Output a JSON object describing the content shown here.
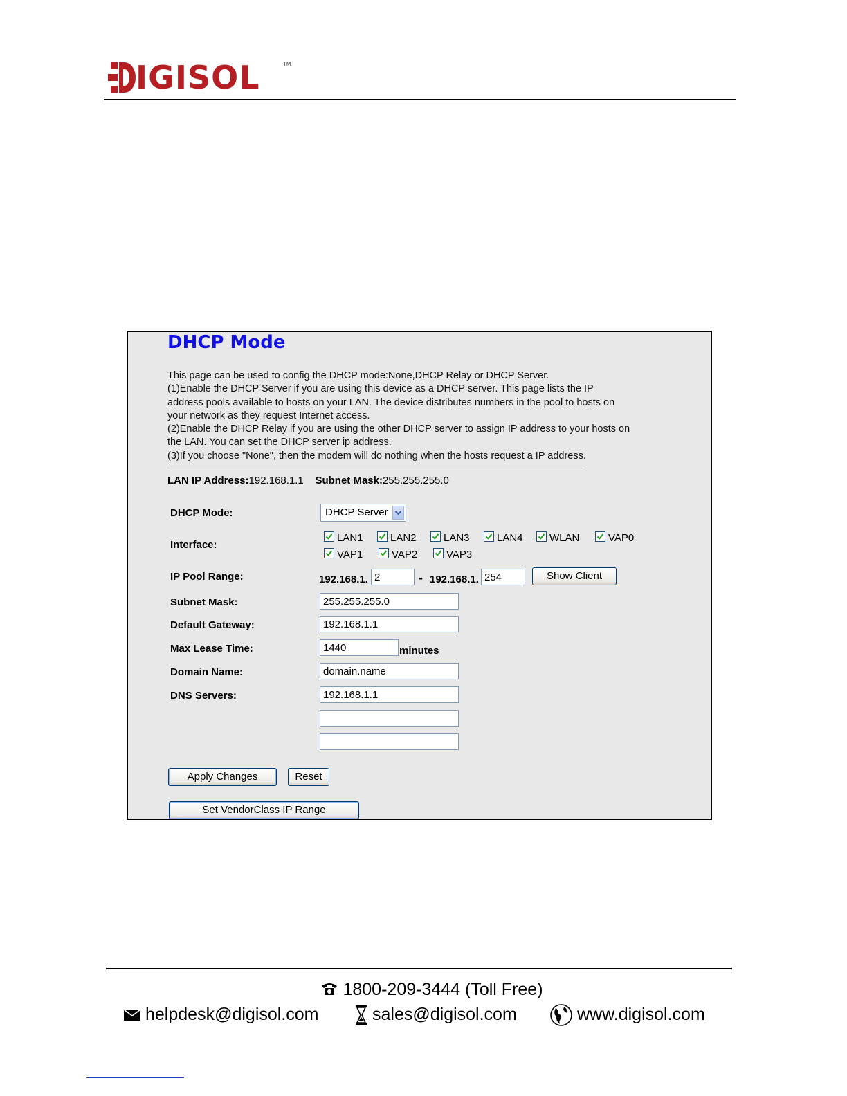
{
  "brand": {
    "logo_text": "IGISOL",
    "trademark": "TM"
  },
  "panel": {
    "title": "DHCP Mode",
    "description": [
      "This page can be used to config the DHCP mode:None,DHCP Relay or DHCP Server.",
      "(1)Enable the DHCP Server if you are using this device as a DHCP server. This page lists the IP",
      "address pools available to hosts on your LAN. The device distributes numbers in the pool to hosts on",
      "your network as they request Internet access.",
      "(2)Enable the DHCP Relay if you are using the other DHCP server to assign IP address to your hosts on",
      "the LAN. You can set the DHCP server ip address.",
      "(3)If you choose \"None\", then the modem will do nothing when the hosts request a IP address."
    ],
    "lan_ip_label": "LAN IP Address:",
    "lan_ip_value": "192.168.1.1",
    "subnet_label": "Subnet Mask:",
    "subnet_value": "255.255.255.0"
  },
  "form": {
    "dhcp_mode_label": "DHCP Mode:",
    "dhcp_mode_value": "DHCP Server",
    "interface_label": "Interface:",
    "interfaces": [
      {
        "label": "LAN1",
        "checked": true
      },
      {
        "label": "LAN2",
        "checked": true
      },
      {
        "label": "LAN3",
        "checked": true
      },
      {
        "label": "LAN4",
        "checked": true
      },
      {
        "label": "WLAN",
        "checked": true
      },
      {
        "label": "VAP0",
        "checked": true
      },
      {
        "label": "VAP1",
        "checked": true
      },
      {
        "label": "VAP2",
        "checked": true
      },
      {
        "label": "VAP3",
        "checked": true
      }
    ],
    "ip_pool_label": "IP Pool Range:",
    "pool_prefix": "192.168.1.",
    "pool_start": "2",
    "pool_dash": "-",
    "pool_end": "254",
    "show_client_label": "Show Client",
    "subnet_mask_label": "Subnet Mask:",
    "subnet_mask_value": "255.255.255.0",
    "gateway_label": "Default Gateway:",
    "gateway_value": "192.168.1.1",
    "lease_label": "Max Lease Time:",
    "lease_value": "1440",
    "lease_unit": "minutes",
    "domain_label": "Domain Name:",
    "domain_value": "domain.name",
    "dns_label": "DNS Servers:",
    "dns1_value": "192.168.1.1",
    "dns2_value": "",
    "dns3_value": "",
    "apply_label": "Apply Changes",
    "reset_label": "Reset",
    "vendor_label": "Set VendorClass IP Range"
  },
  "footer": {
    "phone": "1800-209-3444 (Toll Free)",
    "email": "helpdesk@digisol.com",
    "sales": "sales@digisol.com",
    "web": "www.digisol.com"
  },
  "colors": {
    "brand_red": "#b51f24",
    "title_blue": "#1010e0",
    "panel_bg": "#e8e8e8"
  },
  "icons": [
    "phone-icon",
    "mail-icon",
    "hourglass-icon",
    "globe-icon",
    "chevron-down-icon",
    "checkmark-icon"
  ]
}
